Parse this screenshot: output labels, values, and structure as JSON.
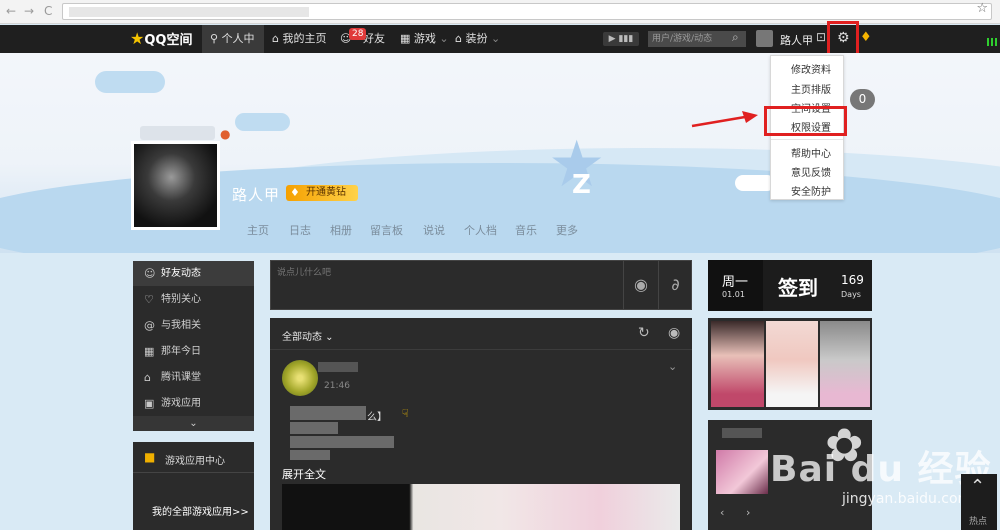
{
  "browser": {
    "back": "←",
    "forward": "→",
    "reload": "C",
    "star": "☆"
  },
  "topbar": {
    "logo": "QQ空间",
    "nav": [
      {
        "label": "个人中心",
        "icon": "person-icon"
      },
      {
        "label": "我的主页",
        "icon": "home-icon"
      },
      {
        "label": "好友",
        "badge": "28",
        "icon": "friends-icon"
      },
      {
        "label": "游戏",
        "icon": "grid-icon"
      },
      {
        "label": "装扮",
        "icon": "shirt-icon"
      }
    ],
    "search_placeholder": "用户/游戏/动态",
    "username": "路人甲"
  },
  "profile": {
    "name": "路人甲",
    "vip_button": "开通黄钻",
    "nav": [
      "主页",
      "日志",
      "相册",
      "留言板",
      "说说",
      "个人档",
      "音乐",
      "更多"
    ],
    "notification_count": "0"
  },
  "dropdown": {
    "items": [
      "修改资料",
      "主页排版",
      "空间设置",
      "权限设置",
      "帮助中心",
      "意见反馈",
      "安全防护"
    ]
  },
  "sidebar": {
    "items": [
      {
        "label": "好友动态",
        "icon": "friends-icon"
      },
      {
        "label": "特别关心",
        "icon": "heart-icon"
      },
      {
        "label": "与我相关",
        "icon": "at-icon"
      },
      {
        "label": "那年今日",
        "icon": "calendar-icon"
      },
      {
        "label": "腾讯课堂",
        "icon": "graduation-icon"
      },
      {
        "label": "游戏应用",
        "icon": "apps-icon"
      }
    ],
    "more": "⌄"
  },
  "game_box": {
    "title": "游戏应用中心",
    "link": "我的全部游戏应用>>"
  },
  "status_input_placeholder": "说点儿什么吧",
  "feed": {
    "title": "全部动态",
    "time": "21:46",
    "text": "么】",
    "expand": "展开全文"
  },
  "checkin": {
    "weekday": "周一",
    "date": "01.01",
    "button": "签到",
    "days_count": "169",
    "days_label": "Days"
  },
  "watermark": {
    "text": "Bai du 经验",
    "url": "jingyan.baidu.com"
  },
  "to_top": {
    "label": "热点"
  },
  "colors": {
    "highlight_red": "#e02020",
    "topbar": "#1f1f1f",
    "panel": "#2b2b2b",
    "vip_gold": "#f5b400"
  }
}
